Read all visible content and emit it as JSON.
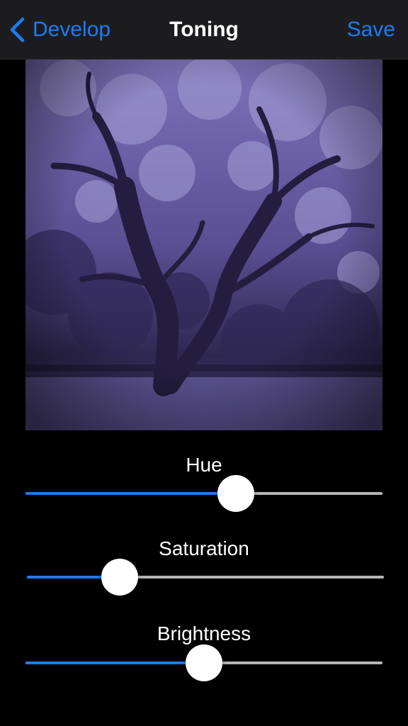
{
  "navbar": {
    "back_label": "Develop",
    "title": "Toning",
    "save_label": "Save"
  },
  "colors": {
    "accent": "#1b7cf2",
    "navbar_bg": "#1c1c1e",
    "photo_tint": "#6a5fa8"
  },
  "sliders": [
    {
      "label": "Hue",
      "value": 0.59
    },
    {
      "label": "Saturation",
      "value": 0.26
    },
    {
      "label": "Brightness",
      "value": 0.5
    }
  ]
}
